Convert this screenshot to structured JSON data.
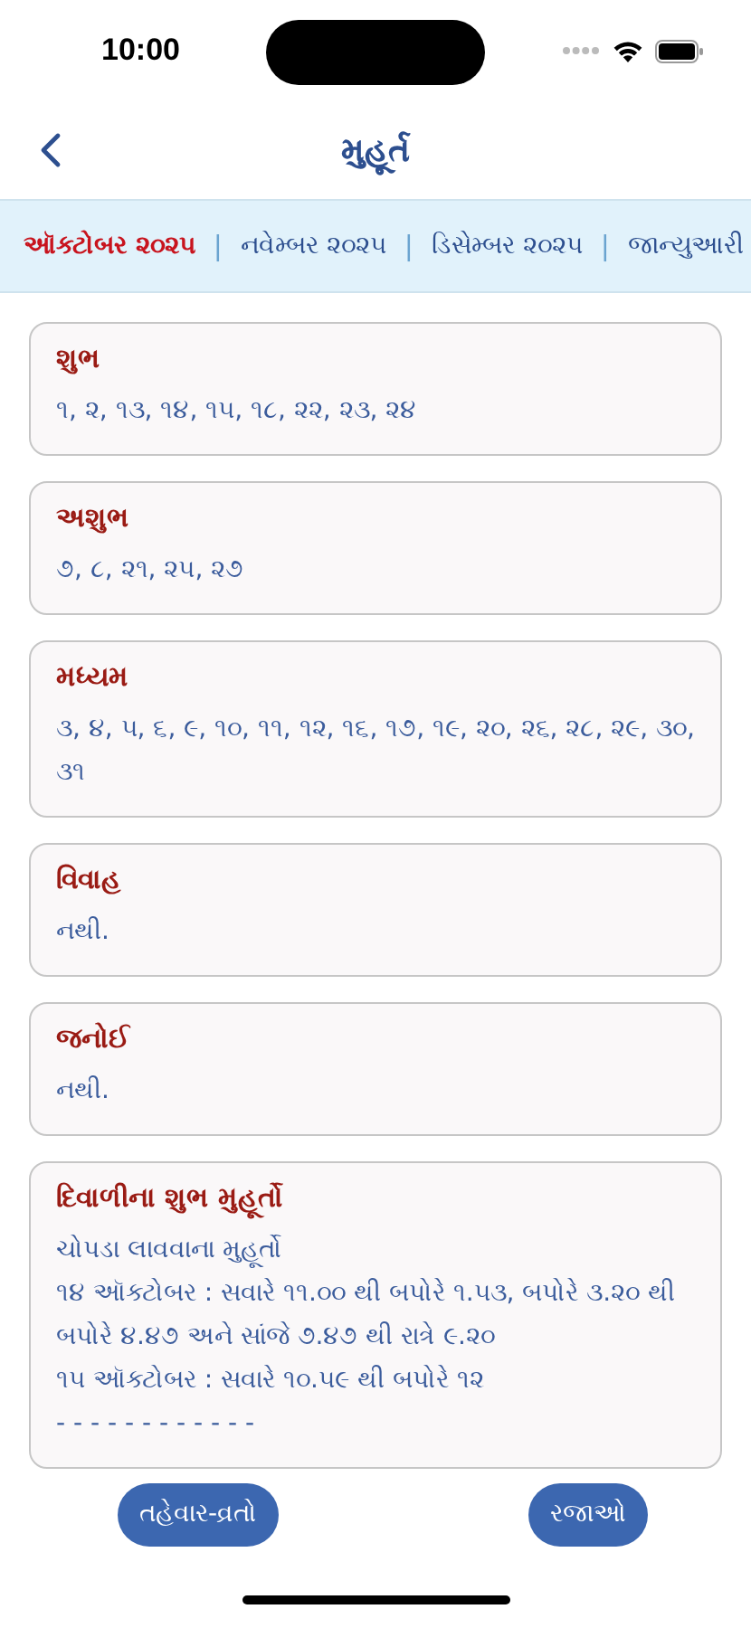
{
  "status_bar": {
    "time": "10:00"
  },
  "header": {
    "title": "મુહૂર્ત"
  },
  "tabs": [
    {
      "label": "ઑક્ટોબર ૨૦૨૫",
      "selected": true
    },
    {
      "label": "નવેમ્બર ૨૦૨૫",
      "selected": false
    },
    {
      "label": "ડિસેમ્બર ૨૦૨૫",
      "selected": false
    },
    {
      "label": "જાન્યુઆરી",
      "selected": false
    }
  ],
  "tab_separator": "|",
  "cards": [
    {
      "title": "શુભ",
      "lines": [
        "૧, ૨, ૧૩, ૧૪, ૧૫, ૧૮, ૨૨, ૨૩, ૨૪"
      ]
    },
    {
      "title": "અશુભ",
      "lines": [
        "૭, ૮, ૨૧, ૨૫, ૨૭"
      ]
    },
    {
      "title": "મધ્યમ",
      "lines": [
        "૩, ૪, ૫, ૬, ૯, ૧૦, ૧૧, ૧૨, ૧૬, ૧૭, ૧૯, ૨૦, ૨૬, ૨૮, ૨૯, ૩૦, ૩૧"
      ]
    },
    {
      "title": "વિવાહ",
      "lines": [
        "નથી."
      ]
    },
    {
      "title": "જનોઈ",
      "lines": [
        "નથી."
      ]
    },
    {
      "title": "દિવાળીના શુભ મુહૂર્તો",
      "lines": [
        "ચોપડા લાવવાના મુહૂર્તો",
        "૧૪ ઑક્ટોબર : સવારે ૧૧.૦૦ થી બપોરે ૧.૫૩, બપોરે ૩.૨૦ થી બપોરે ૪.૪૭ અને સાંજે ૭.૪૭ થી રાત્રે ૯.૨૦",
        "૧૫ ઑક્ટોબર : સવારે ૧૦.૫૯ થી બપોરે ૧૨",
        "- - - - - - - - - - - -"
      ]
    }
  ],
  "buttons": [
    "તહેવાર-વ્રતો",
    "રજાઓ"
  ]
}
